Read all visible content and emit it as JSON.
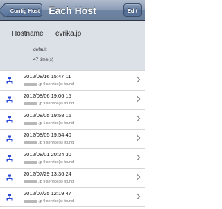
{
  "nav": {
    "back_label": "Config Host",
    "title": "Each Host",
    "edit_label": "Edit"
  },
  "host": {
    "label": "Hostname",
    "value": "evrika.jp",
    "profile": "default",
    "times": "47 time(s)"
  },
  "colors": {
    "nav_bar": "#6d84a2",
    "header_bg": "#dce1e8",
    "icon_blue": "#2b49d6"
  },
  "rows": [
    {
      "title": "2012/08/16 15:47:11",
      "subtitle": ".jp 9 service(s) found",
      "icon": "network-icon"
    },
    {
      "title": "2012/08/06 19:06:15",
      "subtitle": ".jp 9 service(s) found",
      "icon": "network-icon"
    },
    {
      "title": "2012/08/05 19:58:16",
      "subtitle": ".jp 1 service(s) found",
      "icon": "network-icon"
    },
    {
      "title": "2012/08/05 19:54:40",
      "subtitle": ".jp 9 service(s) found",
      "icon": "network-icon"
    },
    {
      "title": "2012/08/01 20:34:30",
      "subtitle": ".jp 9 service(s) found",
      "icon": "network-icon"
    },
    {
      "title": "2012/07/29 13:36:24",
      "subtitle": ".jp 9 service(s) found",
      "icon": "network-icon"
    },
    {
      "title": "2012/07/25 12:19:47",
      "subtitle": ".jp 9 service(s) found",
      "icon": "network-icon"
    }
  ]
}
